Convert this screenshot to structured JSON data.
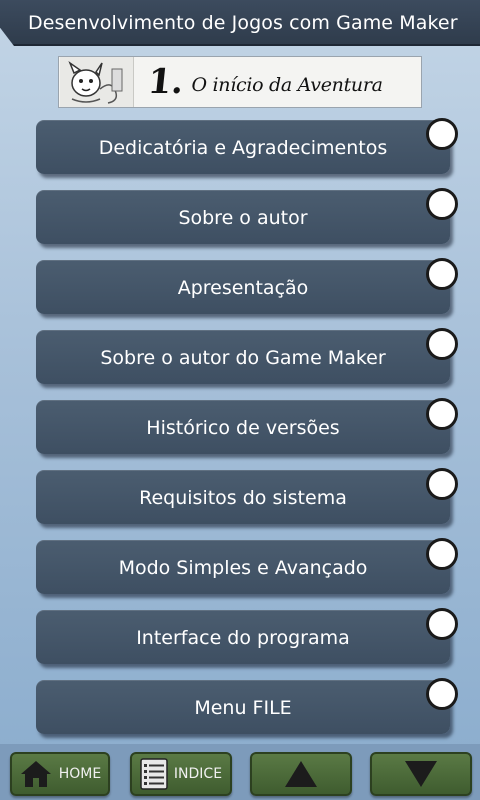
{
  "app": {
    "title": "Desenvolvimento de Jogos com Game Maker"
  },
  "chapter": {
    "number": "1.",
    "title": "O início da Aventura"
  },
  "menu": {
    "items": [
      {
        "label": "Dedicatória e Agradecimentos"
      },
      {
        "label": "Sobre o autor"
      },
      {
        "label": "Apresentação"
      },
      {
        "label": "Sobre o autor do Game Maker"
      },
      {
        "label": "Histórico de versões"
      },
      {
        "label": "Requisitos do sistema"
      },
      {
        "label": "Modo Simples e Avançado"
      },
      {
        "label": "Interface do programa"
      },
      {
        "label": "Menu FILE"
      }
    ]
  },
  "nav": {
    "home_label": "HOME",
    "index_label": "INDICE",
    "home_icon": "house-icon",
    "index_icon": "list-icon",
    "up_icon": "arrow-up-icon",
    "down_icon": "arrow-down-icon"
  },
  "colors": {
    "button": "#445669",
    "nav_green": "#4d6b3a",
    "title_bar": "#354355"
  }
}
